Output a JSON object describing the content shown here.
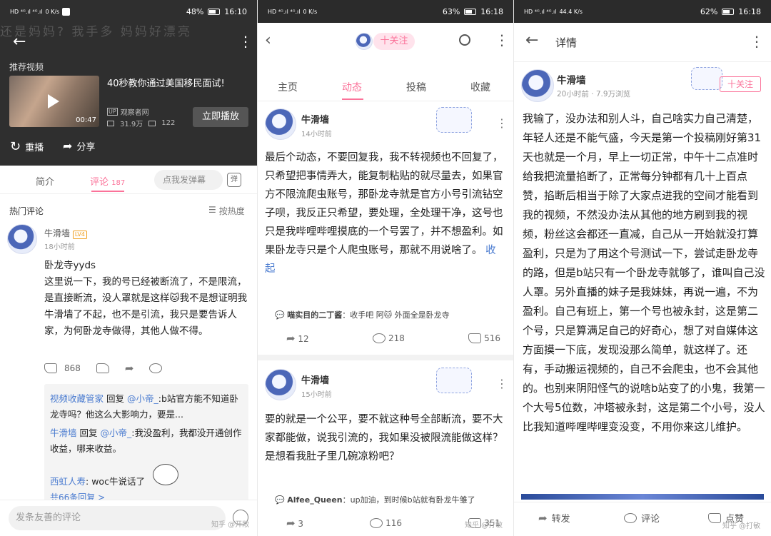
{
  "panel1": {
    "status": {
      "signal": "HD ⁴ᴳ.ıl ⁴ᴳ.ıl",
      "speed": "0 K/s",
      "battery": "48%",
      "time": "16:10"
    },
    "video_bg_text": "还是妈妈? 我手多 妈妈好漂亮",
    "recommend_label": "推荐视频",
    "video_title": "40秒教你通过美国移民面试!",
    "video_duration": "00:47",
    "up_badge": "UP",
    "uploader": "观察者网",
    "views": "31.9万",
    "danmaku": "122",
    "play_now": "立即播放",
    "replay": "重播",
    "share": "分享",
    "tabs": {
      "intro": "简介",
      "comments": "评论",
      "comments_count": "187"
    },
    "danmaku_input": "点我发弹幕",
    "danmaku_icon": "弹",
    "hot_comments": "热门评论",
    "sort_by": "按热度",
    "comment": {
      "user": "牛滑墙",
      "level": "LV4",
      "time": "18小时前",
      "title": "卧龙寺yyds",
      "body1": "这里说一下，我的号已经被断流了，不是限流，是直接断流，没人罩就是这样",
      "emoji": "🐱",
      "body2": "我不是想证明我牛滑墙了不起，也不是引流，我只是要告诉人家，为何卧龙寺做得，其他人做不得。",
      "likes": "868"
    },
    "replies": [
      {
        "user": "视频收藏管家",
        "reply_word": "回复",
        "target": "@小帝_",
        "text": ":b站官方能不知道卧龙寺吗？他这么大影响力，要是..."
      },
      {
        "user": "牛滑墙",
        "reply_word": "回复",
        "target": "@小帝_",
        "text": ":我没盈利，我都没开通创作收益，哪来收益。"
      },
      {
        "user": "西虹人寿",
        "reply_word": "",
        "target": "",
        "text": ": woc牛说话了"
      }
    ],
    "more_replies": "共66条回复 >",
    "comment_input": "发条友善的评论",
    "watermark": "知乎 @开敞"
  },
  "panel2": {
    "status": {
      "signal": "HD ⁴ᴳ.ıl ⁴ᴳ.ıl",
      "speed": "0 K/s",
      "battery": "63%",
      "time": "16:18"
    },
    "follow": "十关注",
    "tabs": [
      "主页",
      "动态",
      "投稿",
      "收藏"
    ],
    "post1": {
      "user": "牛滑墙",
      "time": "14小时前",
      "text": "最后个动态，不要回复我，我不转视频也不回复了，只希望把事情弄大，能复制粘贴的就尽量去，如果官方不限流爬虫账号，那卧龙寺就是官方小号引流钻空子呗，我反正只希望，要处理，全处理干净，这号也只是我哔哩哔哩摸底的一个号罢了，并不想盈利。如果卧龙寺只是个人爬虫账号，那就不用说啥了。",
      "collapse": "收起",
      "reply_user": "喵实目的二丁酱",
      "reply_text": "：收手吧 阿🐱 外面全是卧龙寺",
      "shares": "12",
      "comments": "218",
      "likes": "516"
    },
    "post2": {
      "user": "牛滑墙",
      "time": "15小时前",
      "text": "要的就是一个公平，要不就这种号全部断流，要不大家都能做，说我引流的，我如果没被限流能做这样？是想看我肚子里几碗凉粉吧？",
      "reply_user": "Alfee_Queen",
      "reply_text": "：up加油，到时候b站就有卧龙牛雏了",
      "shares": "3",
      "comments": "116",
      "likes": "351"
    },
    "watermark": "知乎 @打敏"
  },
  "panel3": {
    "status": {
      "signal": "HD ⁴ᴳ.ıl ⁴ᴳ.ıl",
      "speed": "44.4 K/s",
      "battery": "62%",
      "time": "16:18"
    },
    "title": "详情",
    "user": "牛滑墙",
    "meta": "20小时前 · 7.9万浏览",
    "follow": "十关注",
    "text": "我输了，没办法和别人斗，自己啥实力自己清楚，年轻人还是不能气盛，今天是第一个投稿刚好第31天也就是一个月，早上一切正常，中午十二点准时给我把流量掐断了，正常每分钟都有几十上百点赞，掐断后相当于除了大家点进我的空间才能看到我的视频，不然没办法从其他的地方刷到我的视频，粉丝这会都还一直减，自己从一开始就没打算盈利，只是为了用这个号测试一下，尝试走卧龙寺的路，但是b站只有一个卧龙寺就够了，谁叫自己没人罩。另外直播的妹子是我妹妹，再说一遍，不为盈利。自己有班上，第一个号也被永封，这是第二个号，只是算满足自己的好奇心，想了对自媒体这方面摸一下底，发现没那么简单，就这样了。还有，手动搬运视频的，自己不会爬虫，也不会其他的。也别来阴阳怪气的说啥b站变了的小鬼，我第一个大号5位数，冲塔被永封，这是第二个小号，没人比我知道哔哩哔哩变没变，不用你来这儿维护。",
    "share": "转发",
    "comment": "评论",
    "like": "点赞",
    "watermark": "知乎 @打敏"
  }
}
